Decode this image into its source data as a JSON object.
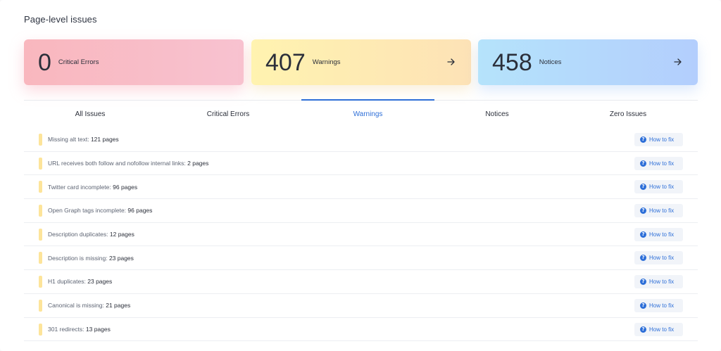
{
  "section": {
    "title": "Page-level issues"
  },
  "cards": [
    {
      "count": "0",
      "label": "Critical Errors",
      "has_arrow": false
    },
    {
      "count": "407",
      "label": "Warnings",
      "has_arrow": true
    },
    {
      "count": "458",
      "label": "Notices",
      "has_arrow": true
    }
  ],
  "tabs": [
    {
      "label": "All Issues",
      "active": false
    },
    {
      "label": "Critical Errors",
      "active": false
    },
    {
      "label": "Warnings",
      "active": true
    },
    {
      "label": "Notices",
      "active": false
    },
    {
      "label": "Zero Issues",
      "active": false
    }
  ],
  "fix_label": "How to fix",
  "issues": [
    {
      "text": "Missing alt text:",
      "count": "121 pages"
    },
    {
      "text": "URL receives both follow and nofollow internal links:",
      "count": "2 pages"
    },
    {
      "text": "Twitter card incomplete:",
      "count": "96 pages"
    },
    {
      "text": "Open Graph tags incomplete:",
      "count": "96 pages"
    },
    {
      "text": "Description duplicates:",
      "count": "12 pages"
    },
    {
      "text": "Description is missing:",
      "count": "23 pages"
    },
    {
      "text": "H1 duplicates:",
      "count": "23 pages"
    },
    {
      "text": "Canonical is missing:",
      "count": "21 pages"
    },
    {
      "text": "301 redirects:",
      "count": "13 pages"
    }
  ],
  "colors": {
    "accent": "#2e6fd8",
    "warning_bar": "#fde49a",
    "critical_gradient": [
      "#f9b7be",
      "#f8c2d0"
    ],
    "warning_gradient": [
      "#fff3b0",
      "#fde2b6"
    ],
    "notice_gradient": [
      "#b5e3fb",
      "#b3cefd"
    ]
  },
  "icons": {
    "card_arrow": "arrow-right-icon",
    "fix": "question-circle-icon"
  }
}
